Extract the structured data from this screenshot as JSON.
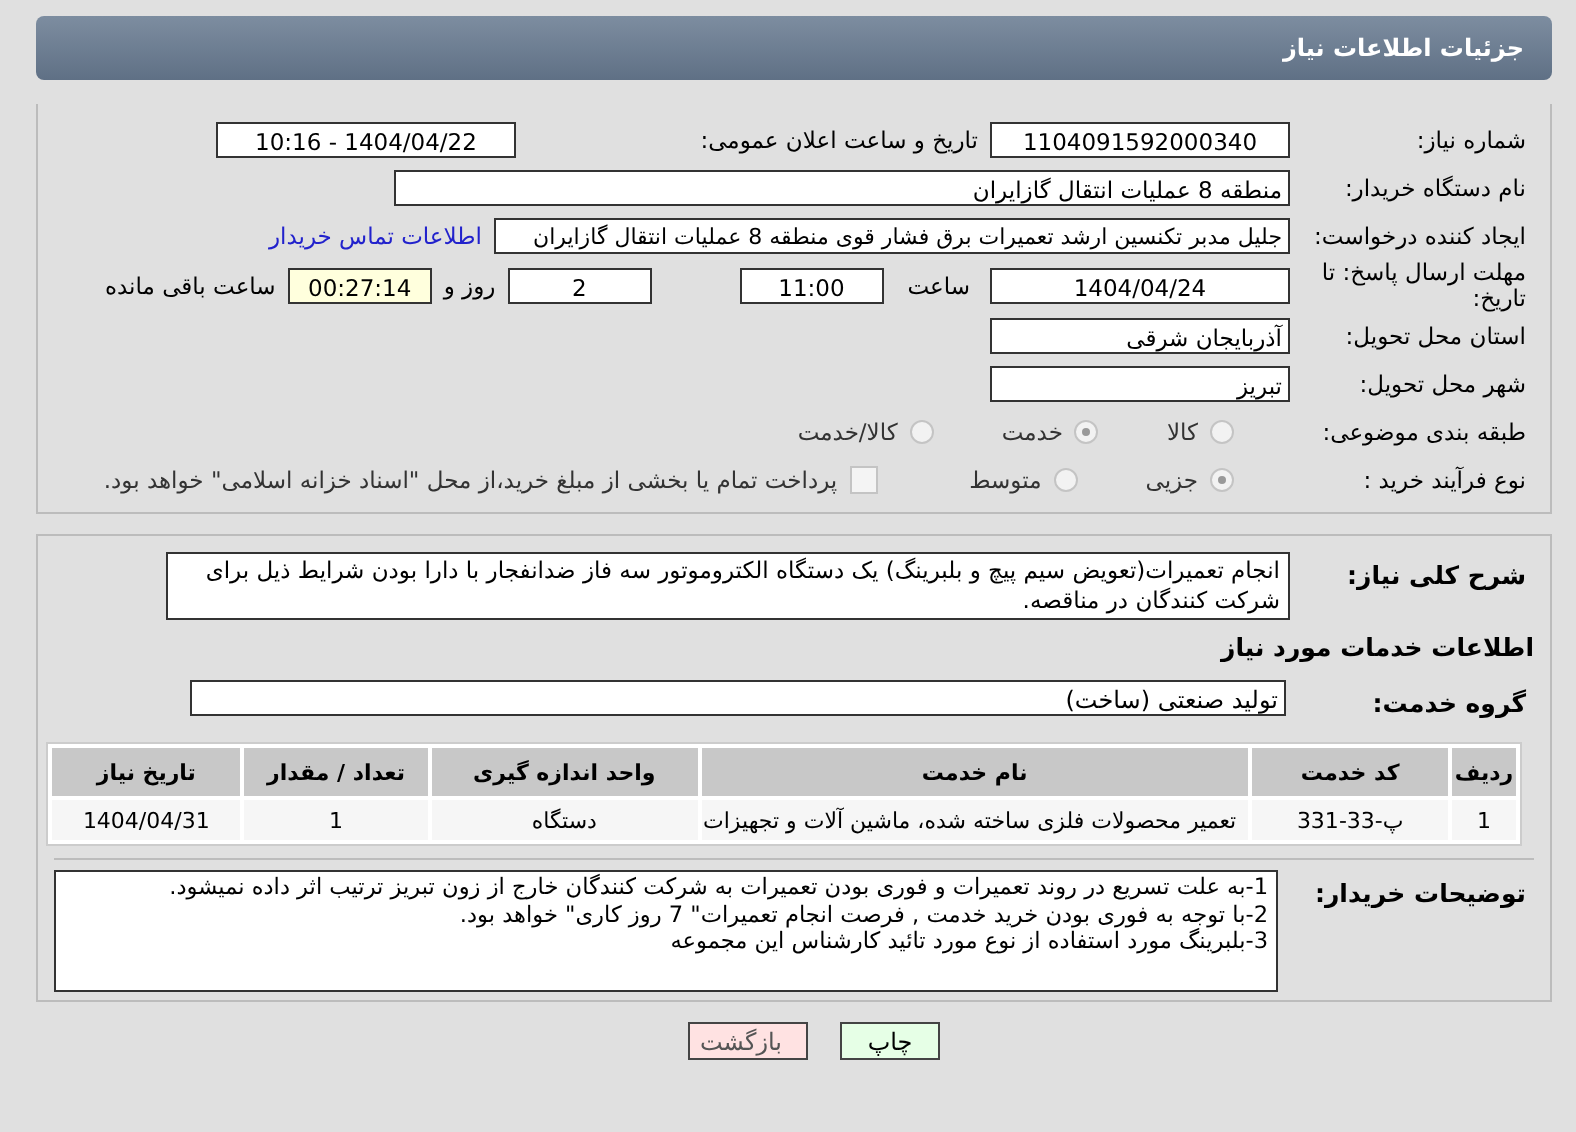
{
  "header": {
    "title": "جزئیات اطلاعات نیاز"
  },
  "need_number": {
    "label": "شماره نیاز:",
    "value": "1104091592000340"
  },
  "announce": {
    "label": "تاریخ و ساعت اعلان عمومی:",
    "value": "1404/04/22 - 10:16"
  },
  "buyer": {
    "label": "نام دستگاه خریدار:",
    "value": "منطقه 8 عملیات انتقال گازایران"
  },
  "requester": {
    "label": "ایجاد کننده درخواست:",
    "value": "جلیل مدبر تکنسین ارشد تعمیرات برق فشار قوی منطقه 8 عملیات انتقال گازایران",
    "link": "اطلاعات تماس خریدار"
  },
  "deadline": {
    "label": "مهلت ارسال پاسخ: تا تاریخ:",
    "date": "1404/04/24",
    "time_label": "ساعت",
    "time": "11:00",
    "days": "2",
    "days_label": "روز و",
    "remaining": "00:27:14",
    "remaining_label": "ساعت باقی مانده"
  },
  "province": {
    "label": "استان محل تحویل:",
    "value": "آذربایجان شرقی"
  },
  "city": {
    "label": "شهر محل تحویل:",
    "value": "تبریز"
  },
  "category": {
    "label": "طبقه بندی موضوعی:",
    "options": [
      {
        "label": "کالا",
        "selected": false
      },
      {
        "label": "خدمت",
        "selected": true
      },
      {
        "label": "کالا/خدمت",
        "selected": false
      }
    ]
  },
  "process": {
    "label": "نوع فرآیند خرید :",
    "options": [
      {
        "label": "جزیی",
        "selected": true
      },
      {
        "label": "متوسط",
        "selected": false
      }
    ],
    "payment": {
      "checked": false,
      "text": "پرداخت تمام یا بخشی از مبلغ خرید،از محل \"اسناد خزانه اسلامی\" خواهد بود."
    }
  },
  "description": {
    "label": "شرح کلی نیاز:",
    "value": "انجام تعمیرات(تعویض سیم پیچ و بلبرینگ) یک دستگاه الکتروموتور سه فاز ضدانفجار با دارا بودن شرایط ذیل برای شرکت کنندگان در مناقصه."
  },
  "services_title": "اطلاعات خدمات مورد نیاز",
  "service_group": {
    "label": "گروه خدمت:",
    "value": "تولید صنعتی (ساخت)"
  },
  "table": {
    "columns": [
      "ردیف",
      "کد خدمت",
      "نام خدمت",
      "واحد اندازه گیری",
      "تعداد / مقدار",
      "تاریخ نیاز"
    ],
    "rows": [
      [
        "1",
        "پ-33-331",
        "تعمیر محصولات فلزی ساخته شده، ماشین آلات و تجهیزات",
        "دستگاه",
        "1",
        "1404/04/31"
      ]
    ]
  },
  "notes": {
    "label": "توضیحات خریدار:",
    "lines": [
      "1-به علت تسریع در روند تعمیرات و فوری بودن تعمیرات به شرکت کنندگان خارج از زون تبریز ترتیب اثر داده نمیشود.",
      "2-با توجه به فوری بودن خرید خدمت , فرصت انجام تعمیرات\" 7 روز کاری\" خواهد بود.",
      "3-بلبرینگ مورد استفاده از نوع مورد تائید کارشناس این مجموعه"
    ]
  },
  "buttons": [
    {
      "label": "چاپ",
      "kind": "print"
    },
    {
      "label": "بازگشت",
      "kind": "back"
    }
  ]
}
